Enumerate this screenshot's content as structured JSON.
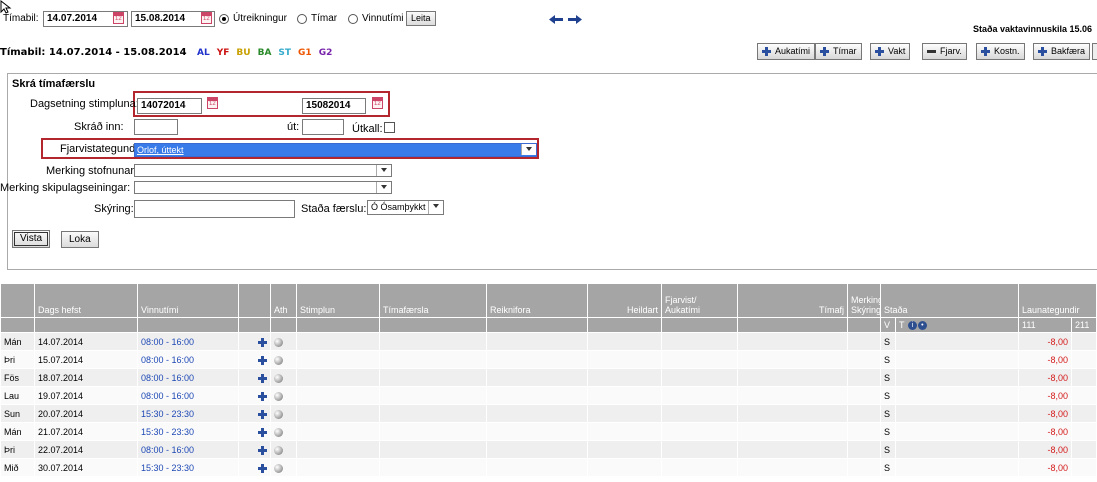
{
  "filter": {
    "label": "Tímabil:",
    "from": "14.07.2014",
    "to": "15.08.2014",
    "radios": [
      {
        "label": "Útreikningur",
        "checked": true
      },
      {
        "label": "Tímar",
        "checked": false
      },
      {
        "label": "Vinnutími",
        "checked": false
      }
    ],
    "search_label": "Leita",
    "status_text": "Staða vaktavinnuskila 15.06"
  },
  "period": {
    "title": "Tímabil: 14.07.2014 - 15.08.2014",
    "codes": [
      {
        "code": "AL",
        "color": "#2233cc"
      },
      {
        "code": "YF",
        "color": "#cc1111"
      },
      {
        "code": "BU",
        "color": "#c8a000"
      },
      {
        "code": "BA",
        "color": "#2a8a2a"
      },
      {
        "code": "ST",
        "color": "#33aacc"
      },
      {
        "code": "G1",
        "color": "#ee5500"
      },
      {
        "code": "G2",
        "color": "#7722aa"
      }
    ]
  },
  "toolbar": {
    "aukatimi": "Aukatími",
    "timar": "Tímar",
    "vakt": "Vakt",
    "fjarv": "Fjarv.",
    "kostn": "Kostn.",
    "bakfaera": "Bakfæra"
  },
  "form": {
    "title": "Skrá tímafærslu",
    "date_label": "Dagsetning stimpluna:",
    "date_from": "14072014",
    "date_to": "15082014",
    "in_label": "Skráð inn:",
    "out_label": "út:",
    "utkall_label": "Útkall:",
    "absence_label": "Fjarvistategund:",
    "absence_value": "Orlof, úttekt",
    "org_label": "Merking stofnunar:",
    "unit_label": "Merking skipulagseiningar:",
    "note_label": "Skýring:",
    "status_label": "Staða færslu:",
    "status_value": "Ó Ósamþykkt",
    "save_label": "Vista",
    "close_label": "Loka"
  },
  "table": {
    "headers": {
      "dags": "Dags hefst",
      "vinnutimi": "Vinnutími",
      "ath": "Ath",
      "stimplun": "Stimplun",
      "timafaersla": "Tímafærsla",
      "reiknifora": "Reiknifora",
      "heildart": "Heildart",
      "fjarvist": "Fjarvist/",
      "aukatimi": "Aukatími",
      "timafj": "Tímafj",
      "merking": "Merking/",
      "skyring": "Skýring",
      "stada": "Staða",
      "launategundir": "Launategundir"
    },
    "sub": {
      "v": "V",
      "t": "T",
      "col111": "111",
      "col211": "211"
    },
    "rows": [
      {
        "day": "Mán",
        "date": "14.07.2014",
        "time": "08:00 - 16:00",
        "stada": "S",
        "value": "-8,00"
      },
      {
        "day": "Þri",
        "date": "15.07.2014",
        "time": "08:00 - 16:00",
        "stada": "S",
        "value": "-8,00"
      },
      {
        "day": "Fös",
        "date": "18.07.2014",
        "time": "08:00 - 16:00",
        "stada": "S",
        "value": "-8,00"
      },
      {
        "day": "Lau",
        "date": "19.07.2014",
        "time": "08:00 - 16:00",
        "stada": "S",
        "value": "-8,00"
      },
      {
        "day": "Sun",
        "date": "20.07.2014",
        "time": "15:30 - 23:30",
        "stada": "S",
        "value": "-8,00"
      },
      {
        "day": "Mán",
        "date": "21.07.2014",
        "time": "15:30 - 23:30",
        "stada": "S",
        "value": "-8,00"
      },
      {
        "day": "Þri",
        "date": "22.07.2014",
        "time": "08:00 - 16:00",
        "stada": "S",
        "value": "-8,00"
      },
      {
        "day": "Mið",
        "date": "30.07.2014",
        "time": "15:30 - 23:30",
        "stada": "S",
        "value": "-8,00"
      }
    ]
  }
}
